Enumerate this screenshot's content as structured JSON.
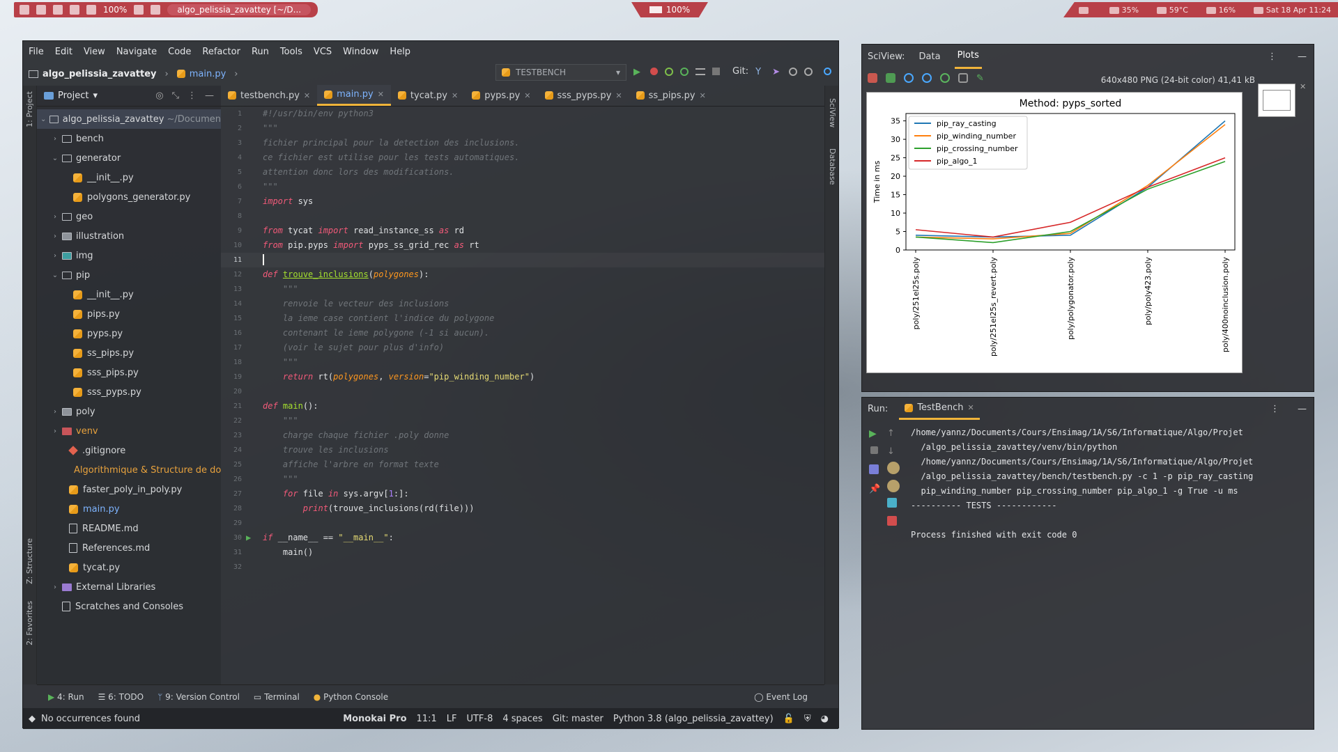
{
  "topbar": {
    "cpu_pct": "100%",
    "window_title": "algo_pelissia_zavattey [~/D...",
    "battery": "100%",
    "net": "35%",
    "temp": "59°C",
    "vol": "16%",
    "datetime": "Sat 18 Apr 11:24"
  },
  "ide": {
    "menu": [
      "File",
      "Edit",
      "View",
      "Navigate",
      "Code",
      "Refactor",
      "Run",
      "Tools",
      "VCS",
      "Window",
      "Help"
    ],
    "breadcrumb": {
      "project": "algo_pelissia_zavattey",
      "file": "main.py"
    },
    "run_config": "TESTBENCH",
    "git_label": "Git:",
    "left_strip": {
      "project": "1: Project",
      "structure": "Z: Structure",
      "favorites": "2: Favorites"
    },
    "right_strip": {
      "sciview": "SciView",
      "database": "Database"
    },
    "project_panel": {
      "title": "Project",
      "root": "algo_pelissia_zavattey",
      "root_path": "~/Documen",
      "items": {
        "bench": "bench",
        "generator": "generator",
        "gen_init": "__init__.py",
        "gen_polygons": "polygons_generator.py",
        "geo": "geo",
        "illustration": "illustration",
        "img": "img",
        "pip": "pip",
        "pip_init": "__init__.py",
        "pips": "pips.py",
        "pyps": "pyps.py",
        "ss_pips": "ss_pips.py",
        "sss_pips": "sss_pips.py",
        "sss_pyps": "sss_pyps.py",
        "poly": "poly",
        "venv": "venv",
        "gitignore": ".gitignore",
        "algo_pdf": "Algorithmique & Structure de dor",
        "faster": "faster_poly_in_poly.py",
        "main": "main.py",
        "readme": "README.md",
        "references": "References.md",
        "tycat": "tycat.py",
        "external": "External Libraries",
        "scratches": "Scratches and Consoles"
      }
    },
    "tabs": [
      "testbench.py",
      "main.py",
      "tycat.py",
      "pyps.py",
      "sss_pyps.py",
      "ss_pips.py"
    ],
    "code": {
      "l1": "#!/usr/bin/env python3",
      "l2": "\"\"\"",
      "l3": "fichier principal pour la detection des inclusions.",
      "l4": "ce fichier est utilise pour les tests automatiques.",
      "l5": "attention donc lors des modifications.",
      "l6": "\"\"\"",
      "l7_kw": "import",
      "l7_rest": " sys",
      "l9_kw": "from",
      "l9_a": " tycat ",
      "l9_kw2": "import",
      "l9_b": " read_instance_ss ",
      "l9_kw3": "as",
      "l9_c": " rd",
      "l10_kw": "from",
      "l10_a": " pip.pyps ",
      "l10_kw2": "import",
      "l10_b": " pyps_ss_grid_rec ",
      "l10_kw3": "as",
      "l10_c": " rt",
      "l12_kw": "def",
      "l12_fn": "trouve_inclusions",
      "l12_p1": "(",
      "l12_arg": "polygones",
      "l12_p2": "):",
      "l13": "    \"\"\"",
      "l14": "    renvoie le vecteur des inclusions",
      "l15": "    la ieme case contient l'indice du polygone",
      "l16": "    contenant le ieme polygone (-1 si aucun).",
      "l17": "    (voir le sujet pour plus d'info)",
      "l18": "    \"\"\"",
      "l19_kw": "    return",
      "l19_a": " rt(",
      "l19_arg": "polygones",
      "l19_b": ", ",
      "l19_arg2": "version",
      "l19_c": "=",
      "l19_str": "\"pip_winding_number\"",
      "l19_d": ")",
      "l21_kw": "def",
      "l21_fn": "main",
      "l21_rest": "():",
      "l22": "    \"\"\"",
      "l23": "    charge chaque fichier .poly donne",
      "l24": "    trouve les inclusions",
      "l25": "    affiche l'arbre en format texte",
      "l26": "    \"\"\"",
      "l27_kw": "    for",
      "l27_a": " file ",
      "l27_kw2": "in",
      "l27_b": " sys.argv[",
      "l27_num": "1",
      "l27_c": ":]:",
      "l28_kw": "        print",
      "l28_rest": "(trouve_inclusions(rd(file)))",
      "l30_kw": "if",
      "l30_a": " __name__ == ",
      "l30_str": "\"__main__\"",
      "l30_b": ":",
      "l31": "    main()"
    },
    "line_numbers": [
      "1",
      "2",
      "3",
      "4",
      "5",
      "6",
      "7",
      "8",
      "9",
      "10",
      "11",
      "12",
      "13",
      "14",
      "15",
      "16",
      "17",
      "18",
      "19",
      "20",
      "21",
      "22",
      "23",
      "24",
      "25",
      "26",
      "27",
      "28",
      "29",
      "30",
      "31",
      "32"
    ],
    "tool_tabs": [
      "4: Run",
      "6: TODO",
      "9: Version Control",
      "Terminal",
      "Python Console"
    ],
    "event_log": "Event Log",
    "status": {
      "message": "No occurrences found",
      "theme": "Monokai Pro",
      "position": "11:1",
      "line_sep": "LF",
      "encoding": "UTF-8",
      "indent": "4 spaces",
      "git": "Git: master",
      "interpreter": "Python 3.8 (algo_pelissia_zavattey)"
    }
  },
  "sciview": {
    "label": "SciView:",
    "tabs": [
      "Data",
      "Plots"
    ],
    "image_info": "640x480 PNG (24-bit color) 41,41 kB"
  },
  "run": {
    "label": "Run:",
    "tab": "TestBench",
    "lines": [
      "/home/yannz/Documents/Cours/Ensimag/1A/S6/Informatique/Algo/Projet",
      "  /algo_pelissia_zavattey/venv/bin/python",
      "  /home/yannz/Documents/Cours/Ensimag/1A/S6/Informatique/Algo/Projet",
      "  /algo_pelissia_zavattey/bench/testbench.py -c 1 -p pip_ray_casting",
      "  pip_winding_number pip_crossing_number pip_algo_1 -g True -u ms",
      "---------- TESTS ------------",
      "",
      "Process finished with exit code 0"
    ]
  },
  "colors": {
    "accent": "#f0b43a",
    "panel": "#2c2e32",
    "link": "#7eb4ff"
  },
  "chart_data": {
    "type": "line",
    "title": "Method: pyps_sorted",
    "ylabel": "Time in ms",
    "xlabel": "",
    "categories": [
      "poly/251el25s.poly",
      "poly/251el25s_revert.poly",
      "poly/polygonator.poly",
      "poly/poly423.poly",
      "poly/400noinclusion.poly"
    ],
    "ylim": [
      0,
      37
    ],
    "yticks": [
      0,
      5,
      10,
      15,
      20,
      25,
      30,
      35
    ],
    "legend_position": "top-left",
    "grid": false,
    "series": [
      {
        "name": "pip_ray_casting",
        "color": "#1f77b4",
        "values": [
          4.0,
          3.5,
          4.0,
          17.0,
          35.0
        ]
      },
      {
        "name": "pip_winding_number",
        "color": "#ff7f0e",
        "values": [
          3.5,
          3.0,
          4.5,
          17.5,
          34.0
        ]
      },
      {
        "name": "pip_crossing_number",
        "color": "#2ca02c",
        "values": [
          3.5,
          2.0,
          5.0,
          16.5,
          24.0
        ]
      },
      {
        "name": "pip_algo_1",
        "color": "#d62728",
        "values": [
          5.5,
          3.5,
          7.5,
          17.0,
          25.0
        ]
      }
    ]
  }
}
